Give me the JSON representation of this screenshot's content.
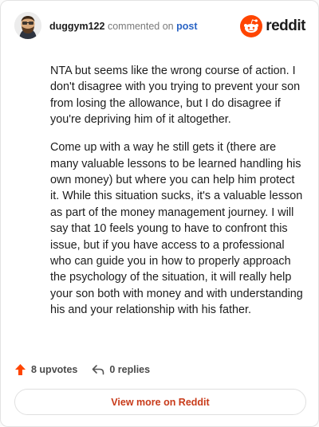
{
  "comment": {
    "username": "duggym122",
    "action_text": "commented on",
    "target_link": "post",
    "paragraphs": [
      "NTA but seems like the wrong course of action. I don't disagree with you trying to prevent your son from losing the allowance, but I do disagree if you're depriving him of it altogether.",
      "Come up with a way he still gets it (there are many valuable lessons to be learned handling his own money) but where you can help him protect it. While this situation sucks, it's a valuable lesson as part of the money management journey. I will say that 10 feels young to have to confront this issue, but if you have access to a professional who can guide you in how to properly approach the psychology of the situation, it will really help your son both with money and with understanding his and your relationship with his father."
    ]
  },
  "brand": {
    "name": "reddit",
    "icon": "reddit-snoo-icon",
    "color": "#ff4500"
  },
  "actions": {
    "upvotes_label": "8 upvotes",
    "replies_label": "0 replies",
    "upvote_icon": "upvote-arrow-icon",
    "reply_icon": "reply-arrow-icon"
  },
  "footer": {
    "view_more_label": "View more on Reddit"
  },
  "colors": {
    "accent": "#ff4500",
    "link": "#2a64c5",
    "view_more": "#c83b1a"
  }
}
